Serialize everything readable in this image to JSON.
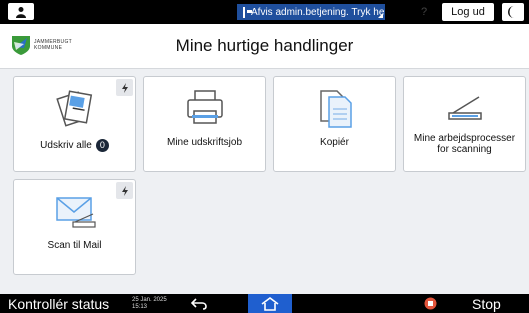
{
  "topbar": {
    "user_icon": "user-icon",
    "notice_text": "Afvis admin.betjening. Tryk her",
    "help_label": "?",
    "logout_label": "Log ud",
    "night_mode_icon": "moon-icon"
  },
  "header": {
    "logo_text": "JAMMERBUGT KOMMUNE",
    "title": "Mine hurtige handlinger"
  },
  "tiles": [
    {
      "label": "Udskriv alle",
      "badge": "0",
      "icon": "print-documents-icon",
      "quick": true
    },
    {
      "label": "Mine udskriftsjob",
      "icon": "printer-icon",
      "quick": false
    },
    {
      "label": "Kopiér",
      "icon": "copy-documents-icon",
      "quick": false
    },
    {
      "label": "Mine arbejdsprocesser for scanning",
      "icon": "scanner-icon",
      "quick": false
    },
    {
      "label": "Scan til Mail",
      "icon": "mail-icon",
      "quick": true
    }
  ],
  "bottombar": {
    "status_label": "Kontrollér status",
    "date": "25 Jan. 2025",
    "time": "15:13",
    "back_icon": "back-arrow-icon",
    "home_icon": "home-icon",
    "stop_label": "Stop"
  },
  "colors": {
    "accent_blue": "#1f5fcf",
    "notice_blue": "#1f4f9d",
    "stop_red": "#e2553c"
  }
}
